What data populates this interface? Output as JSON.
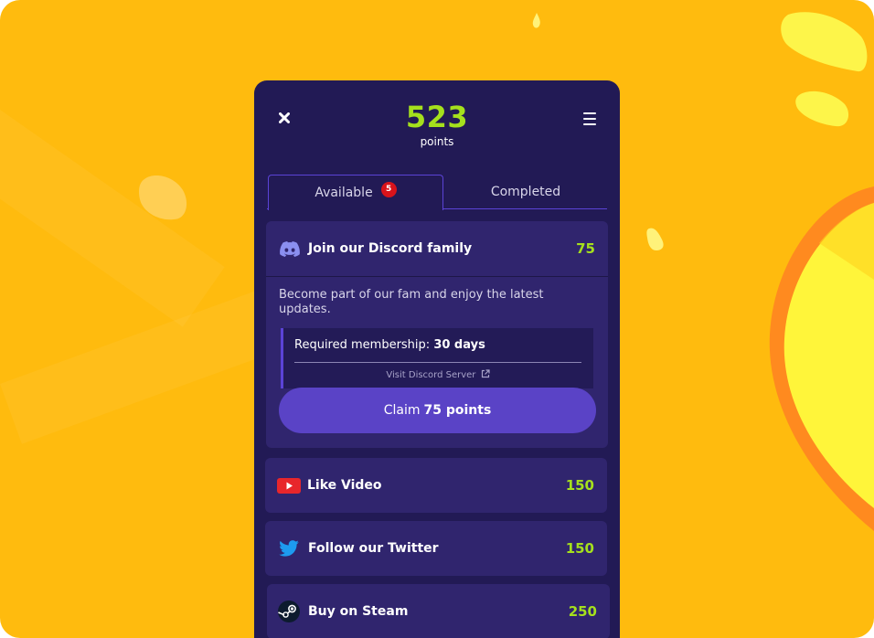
{
  "header": {
    "points_value": "523",
    "points_label": "points"
  },
  "tabs": [
    {
      "label": "Available",
      "badge": "5"
    },
    {
      "label": "Completed"
    }
  ],
  "expanded_task": {
    "title": "Join our Discord family",
    "points": "75",
    "icon": "discord-icon",
    "description": "Become part of our fam and enjoy the latest updates.",
    "requirement_label": "Required membership:",
    "requirement_value": "30 days",
    "link_label": "Visit Discord Server",
    "claim_prefix": "Claim",
    "claim_amount": "75 points"
  },
  "tasks": [
    {
      "title": "Like Video",
      "points": "150",
      "icon": "youtube-icon"
    },
    {
      "title": "Follow our Twitter",
      "points": "150",
      "icon": "twitter-icon"
    },
    {
      "title": "Buy on Steam",
      "points": "250",
      "icon": "steam-icon"
    }
  ],
  "colors": {
    "background": "#ffbb0e",
    "panel": "#221a55",
    "card": "#30256e",
    "accent_green": "#a5e01d",
    "accent_purple": "#5a43c6",
    "badge_red": "#d8131b"
  }
}
